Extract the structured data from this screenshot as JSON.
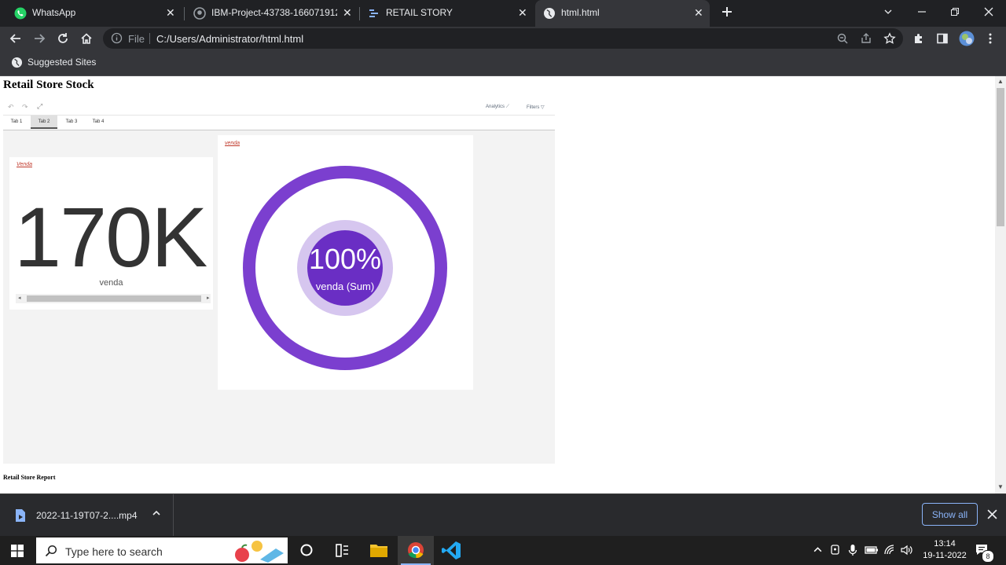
{
  "browser": {
    "tabs": [
      {
        "title": "WhatsApp",
        "icon": "whatsapp-icon",
        "active": false
      },
      {
        "title": "IBM-Project-43738-1660719127/",
        "icon": "github-icon",
        "active": false
      },
      {
        "title": "RETAIL STORY",
        "icon": "dashboard-icon",
        "active": false
      },
      {
        "title": "html.html",
        "icon": "globe-icon",
        "active": true
      }
    ],
    "address": {
      "scheme_label": "File",
      "url": "C:/Users/Administrator/html.html"
    },
    "bookmarks": [
      {
        "label": "Suggested Sites"
      }
    ]
  },
  "page": {
    "title": "Retail Store Stock",
    "report_title": "Retail Store Report",
    "dashboard": {
      "toolbar": {
        "analytics": "Analytics",
        "filters": "Filters"
      },
      "tabs": [
        {
          "label": "Tab 1",
          "active": false
        },
        {
          "label": "Tab 2",
          "active": true
        },
        {
          "label": "Tab 3",
          "active": false
        },
        {
          "label": "Tab 4",
          "active": false
        }
      ],
      "kpi": {
        "label": "Venda",
        "value": "170K",
        "unit": "venda"
      },
      "donut": {
        "label": "venda",
        "percent_text": "100%",
        "sub_label": "venda (Sum)",
        "fraction": 1.0
      }
    }
  },
  "downloads": {
    "file": "2022-11-19T07-2....mp4",
    "show_all": "Show all"
  },
  "taskbar": {
    "search_placeholder": "Type here to search",
    "time": "13:14",
    "date": "19-11-2022",
    "notification_count": "8"
  },
  "colors": {
    "donut_ring": "#7b3fcf",
    "donut_inner_ring": "#d6c6ef",
    "donut_center": "#6a2ec4",
    "accent": "#8ab4f8"
  }
}
